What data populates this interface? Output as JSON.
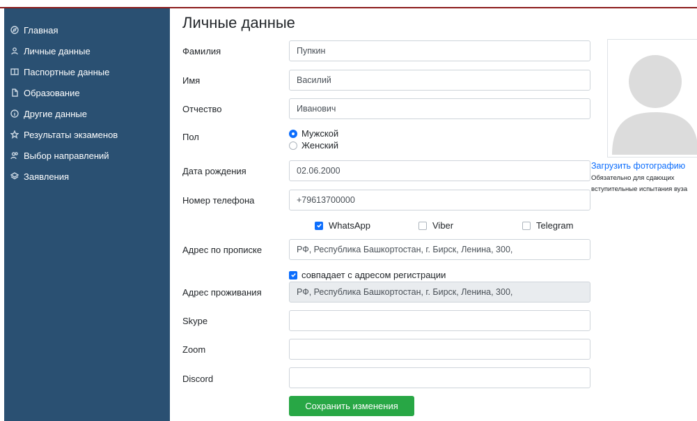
{
  "sidebar": {
    "items": [
      {
        "label": "Главная",
        "icon": "compass-icon"
      },
      {
        "label": "Личные данные",
        "icon": "user-icon"
      },
      {
        "label": "Паспортные данные",
        "icon": "book-icon"
      },
      {
        "label": "Образование",
        "icon": "file-icon"
      },
      {
        "label": "Другие данные",
        "icon": "info-icon"
      },
      {
        "label": "Результаты экзаменов",
        "icon": "star-icon"
      },
      {
        "label": "Выбор направлений",
        "icon": "users-icon"
      },
      {
        "label": "Заявления",
        "icon": "layers-icon"
      }
    ]
  },
  "page": {
    "title": "Личные данные"
  },
  "form": {
    "surname": {
      "label": "Фамилия",
      "value": "Пупкин"
    },
    "name": {
      "label": "Имя",
      "value": "Василий"
    },
    "patronymic": {
      "label": "Отчество",
      "value": "Иванович"
    },
    "gender": {
      "label": "Пол",
      "options": [
        "Мужской",
        "Женский"
      ],
      "selected": "Мужской"
    },
    "birthdate": {
      "label": "Дата рождения",
      "value": "02.06.2000"
    },
    "phone": {
      "label": "Номер телефона",
      "value": "+79613700000"
    },
    "messengers": [
      {
        "label": "WhatsApp",
        "checked": true
      },
      {
        "label": "Viber",
        "checked": false
      },
      {
        "label": "Telegram",
        "checked": false
      }
    ],
    "reg_address": {
      "label": "Адрес по прописке",
      "value": "РФ, Республика Башкортостан, г. Бирск, Ленина, 300,"
    },
    "same_address": {
      "label": "совпадает с адресом регистрации",
      "checked": true
    },
    "live_address": {
      "label": "Адрес проживания",
      "value": "РФ, Республика Башкортостан, г. Бирск, Ленина, 300,"
    },
    "skype": {
      "label": "Skype",
      "value": ""
    },
    "zoom": {
      "label": "Zoom",
      "value": ""
    },
    "discord": {
      "label": "Discord",
      "value": ""
    },
    "save_label": "Сохранить изменения"
  },
  "photo": {
    "upload_label": "Загрузить фотографию",
    "note": "Обязательно для сдающих вступительные испытания вуза"
  },
  "colors": {
    "sidebar": "#2a5072",
    "accent": "#0d6efd",
    "save": "#28a745",
    "topline": "#8b1a1a"
  }
}
